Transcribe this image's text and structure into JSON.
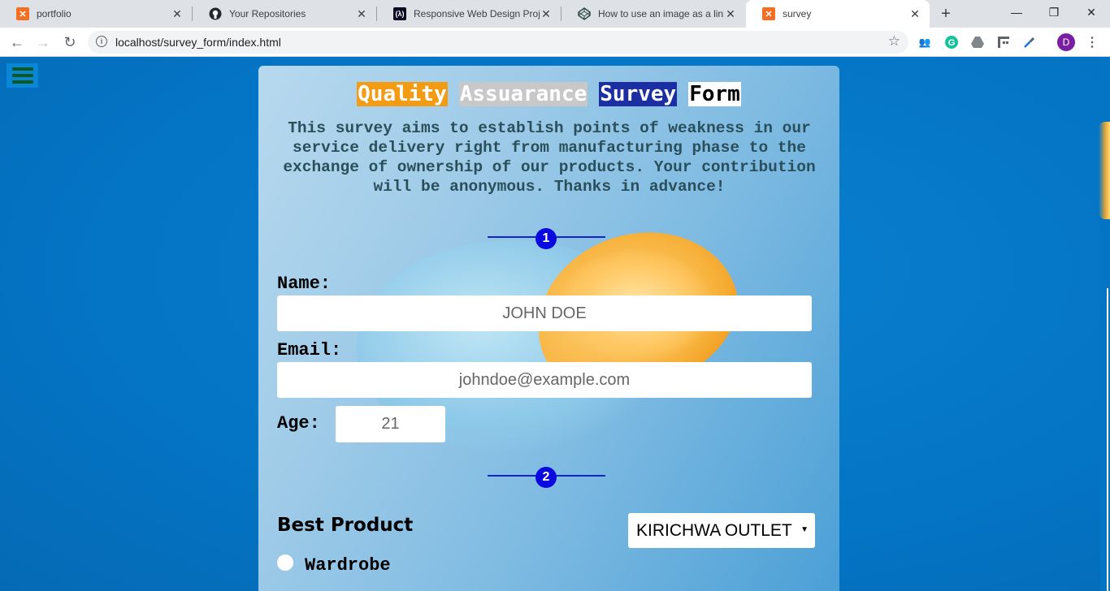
{
  "browser": {
    "tabs": [
      {
        "title": "portfolio",
        "favicon": "xampp-icon"
      },
      {
        "title": "Your Repositories",
        "favicon": "github-icon"
      },
      {
        "title": "Responsive Web Design Projec",
        "favicon": "freecodecamp-icon"
      },
      {
        "title": "How to use an image as a link",
        "favicon": "codepen-icon"
      },
      {
        "title": "survey",
        "favicon": "xampp-icon",
        "active": true
      }
    ],
    "url": "localhost/survey_form/index.html",
    "profile_initial": "D"
  },
  "page": {
    "title_words": [
      "Quality",
      "Assuarance",
      "Survey",
      "Form"
    ],
    "description": "This survey aims to establish points of weakness in our service delivery right from manufacturing phase to the exchange of ownership of our products. Your contribution will be anonymous. Thanks in advance!",
    "steps": [
      "1",
      "2"
    ],
    "name_label": "Name:",
    "name_placeholder": "JOHN DOE",
    "email_label": "Email:",
    "email_placeholder": "johndoe@example.com",
    "age_label": "Age:",
    "age_placeholder": "21",
    "best_product_label": "Best Product",
    "outlet_select_value": "KIRICHWA OUTLET",
    "radio_option_1": "Wardrobe"
  },
  "colors": {
    "page_bg": "#0474c4",
    "title_quality_bg": "#f39b12",
    "title_assuarance_bg": "#c8c8c8",
    "title_survey_bg": "#1b2fa3",
    "step_color": "#0a0ae0"
  }
}
